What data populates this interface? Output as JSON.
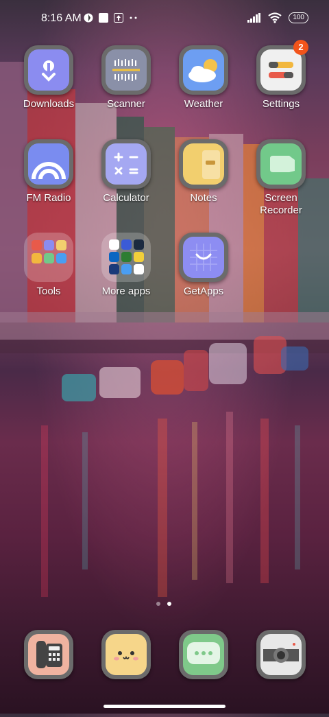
{
  "status_bar": {
    "time": "8:16 AM",
    "battery": "100"
  },
  "home": {
    "apps": [
      {
        "label": "Downloads"
      },
      {
        "label": "Scanner"
      },
      {
        "label": "Weather"
      },
      {
        "label": "Settings",
        "badge": "2"
      },
      {
        "label": "FM Radio"
      },
      {
        "label": "Calculator"
      },
      {
        "label": "Notes"
      },
      {
        "label": "Screen Recorder"
      },
      {
        "label": "Tools"
      },
      {
        "label": "More apps"
      },
      {
        "label": "GetApps"
      }
    ]
  },
  "page_indicator": {
    "pages": 2,
    "current": 2
  },
  "colors": {
    "badge": "#f2541b",
    "accent_purple": "#8b8cf0"
  }
}
